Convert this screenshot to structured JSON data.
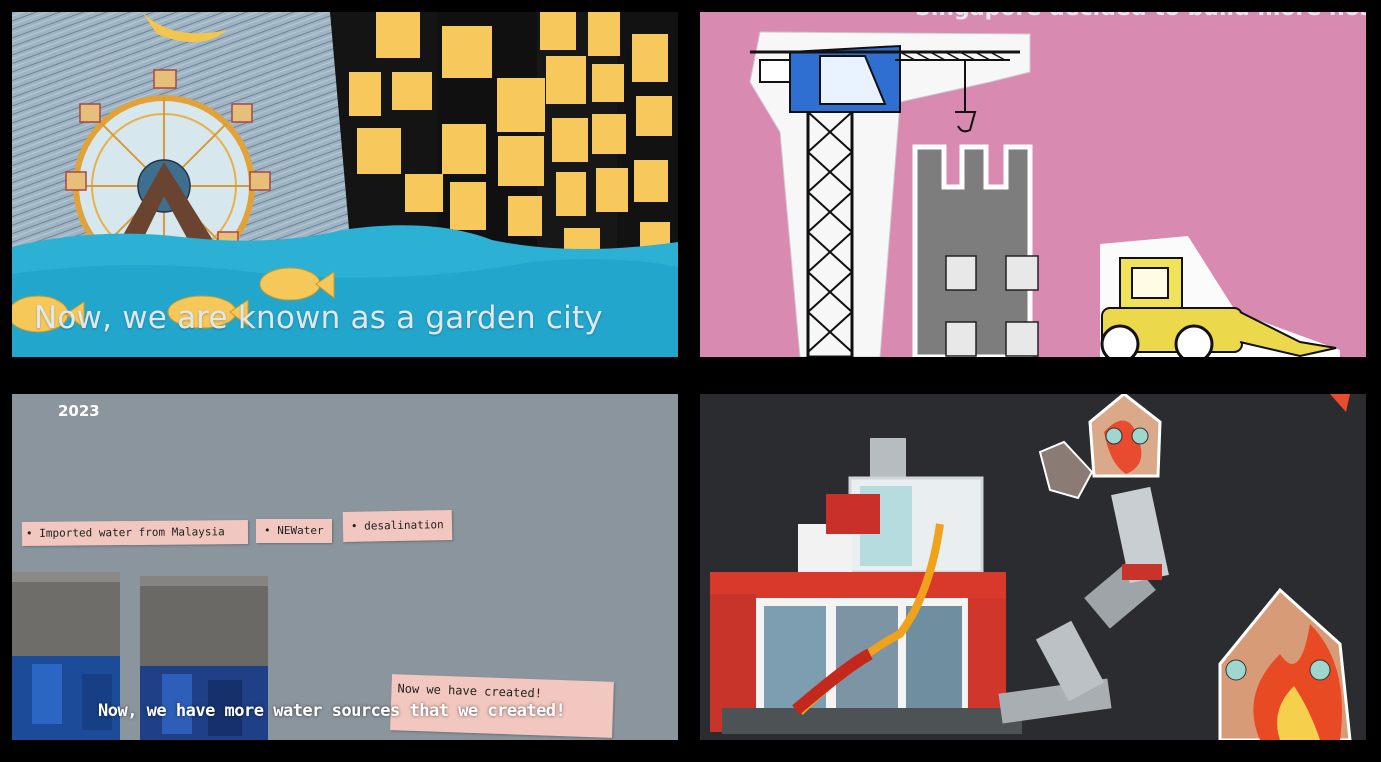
{
  "panels": [
    {
      "id": "garden-city",
      "caption": "Now, we are known as a garden city"
    },
    {
      "id": "construction",
      "caption": "Singapore decided to build more hospitals!"
    },
    {
      "id": "water-sources",
      "year": "2023",
      "notes": [
        "• Imported water from Malaysia",
        "• NEWater",
        "• desalination",
        "Now we have created!"
      ],
      "caption": "Now, we have more water sources that we created!"
    },
    {
      "id": "lego-fire",
      "caption": ""
    }
  ],
  "colors": {
    "sky_scribble": "#8fa6b8",
    "sea": "#29aed0",
    "building_dark": "#151515",
    "window_yellow": "#f7c95c",
    "pink_board": "#d88ab0",
    "grey_board": "#8b959e",
    "dark_board": "#2a2c2f",
    "lego_red": "#d8392b"
  }
}
